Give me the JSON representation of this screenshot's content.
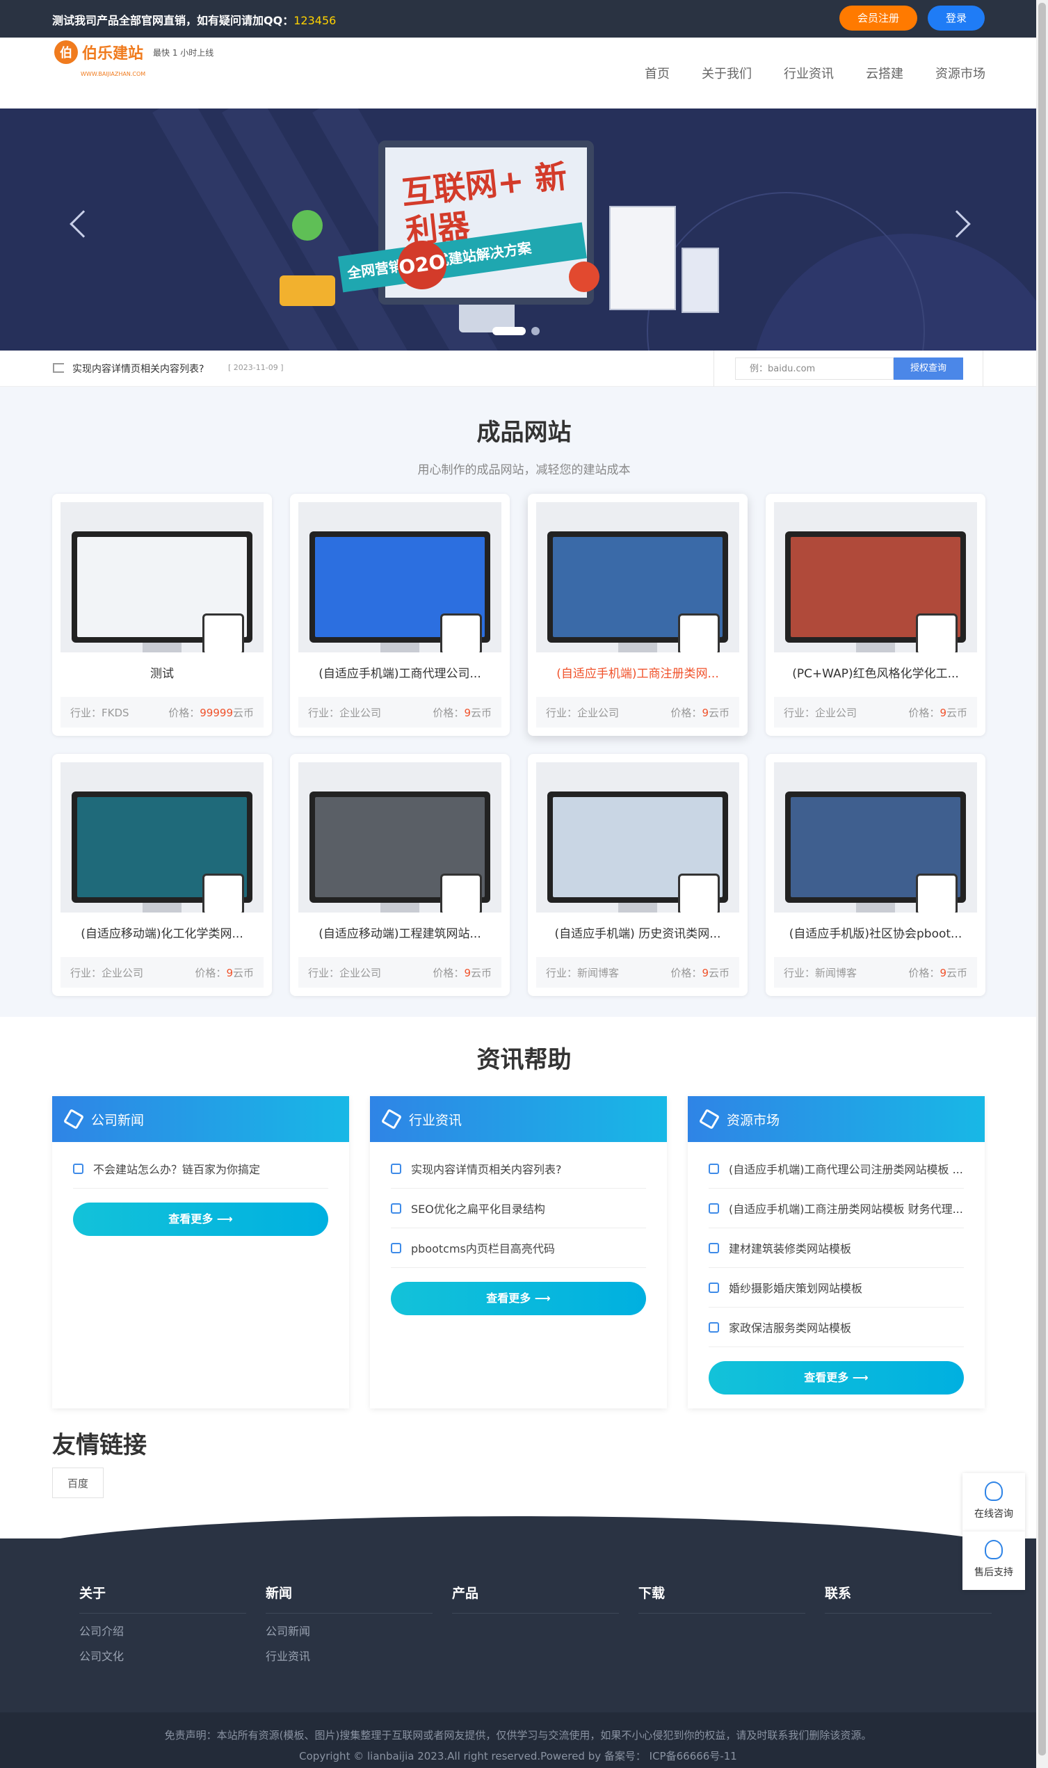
{
  "topbar": {
    "notice": "测试我司产品全部官网直销，如有疑问请加QQ：",
    "qq": "123456",
    "register_label": "会员注册",
    "login_label": "登录"
  },
  "header": {
    "logo_mark": "伯",
    "logo_text": "伯乐建站",
    "logo_sub": "最快 1 小时上线",
    "logo_url": "WWW.BAIJIAZHAN.COM",
    "nav": [
      "首页",
      "关于我们",
      "行业资讯",
      "云搭建",
      "资源市场"
    ]
  },
  "banner": {
    "headline": "互联网+ 新利器",
    "o2o": "O2O",
    "ribbon": "全网营销 一站式建站解决方案"
  },
  "notice_row": {
    "text": "实现内容详情页相关内容列表?",
    "date": "[ 2023-11-09 ]",
    "search_placeholder": "例：baidu.com",
    "search_button": "授权查询"
  },
  "products": {
    "title": "成品网站",
    "subtitle": "用心制作的成品网站，减轻您的建站成本",
    "industry_prefix": "行业：",
    "price_prefix": "价格：",
    "price_unit": "云币",
    "items": [
      {
        "title": "测试",
        "industry": "FKDS",
        "price": "99999",
        "screen_color": "#f2f4f7"
      },
      {
        "title": "(自适应手机端)工商代理公司...",
        "industry": "企业公司",
        "price": "9",
        "screen_color": "#2c6fe0"
      },
      {
        "title": "(自适应手机端)工商注册类网...",
        "industry": "企业公司",
        "price": "9",
        "screen_color": "#3a6aa8"
      },
      {
        "title": "(PC+WAP)红色风格化学化工...",
        "industry": "企业公司",
        "price": "9",
        "screen_color": "#b04a3a"
      },
      {
        "title": "(自适应移动端)化工化学类网...",
        "industry": "企业公司",
        "price": "9",
        "screen_color": "#1f6a7a"
      },
      {
        "title": "(自适应移动端)工程建筑网站...",
        "industry": "企业公司",
        "price": "9",
        "screen_color": "#5a5f66"
      },
      {
        "title": "(自适应手机端) 历史资讯类网...",
        "industry": "新闻博客",
        "price": "9",
        "screen_color": "#c9d6e4"
      },
      {
        "title": "(自适应手机版)社区协会pboot...",
        "industry": "新闻博客",
        "price": "9",
        "screen_color": "#3f5f8f"
      }
    ]
  },
  "news": {
    "title": "资讯帮助",
    "more_label": "查看更多 ⟶",
    "columns": [
      {
        "heading": "公司新闻",
        "items": [
          "不会建站怎么办？链百家为你搞定"
        ]
      },
      {
        "heading": "行业资讯",
        "items": [
          "实现内容详情页相关内容列表?",
          "SEO优化之扁平化目录结构",
          "pbootcms内页栏目高亮代码"
        ]
      },
      {
        "heading": "资源市场",
        "items": [
          "(自适应手机端)工商代理公司注册类网站模板 ...",
          "(自适应手机端)工商注册类网站模板 财务代理...",
          "建材建筑装修类网站模板",
          "婚纱摄影婚庆策划网站模板",
          "家政保洁服务类网站模板"
        ]
      }
    ]
  },
  "links": {
    "title": "友情链接",
    "items": [
      "百度"
    ]
  },
  "float": {
    "online": "在线咨询",
    "support": "售后支持"
  },
  "footer": {
    "columns": [
      {
        "heading": "关于",
        "links": [
          "公司介绍",
          "公司文化"
        ]
      },
      {
        "heading": "新闻",
        "links": [
          "公司新闻",
          "行业资讯"
        ]
      },
      {
        "heading": "产品",
        "links": []
      },
      {
        "heading": "下载",
        "links": []
      },
      {
        "heading": "联系",
        "links": []
      }
    ],
    "disclaimer": "免责声明：本站所有资源(模板、图片)搜集整理于互联网或者网友提供，仅供学习与交流使用，如果不小心侵犯到你的权益，请及时联系我们删除该资源。",
    "copyright": "Copyright © lianbaijia 2023.All right reserved.Powered by 备案号： ICP备66666号-11"
  }
}
